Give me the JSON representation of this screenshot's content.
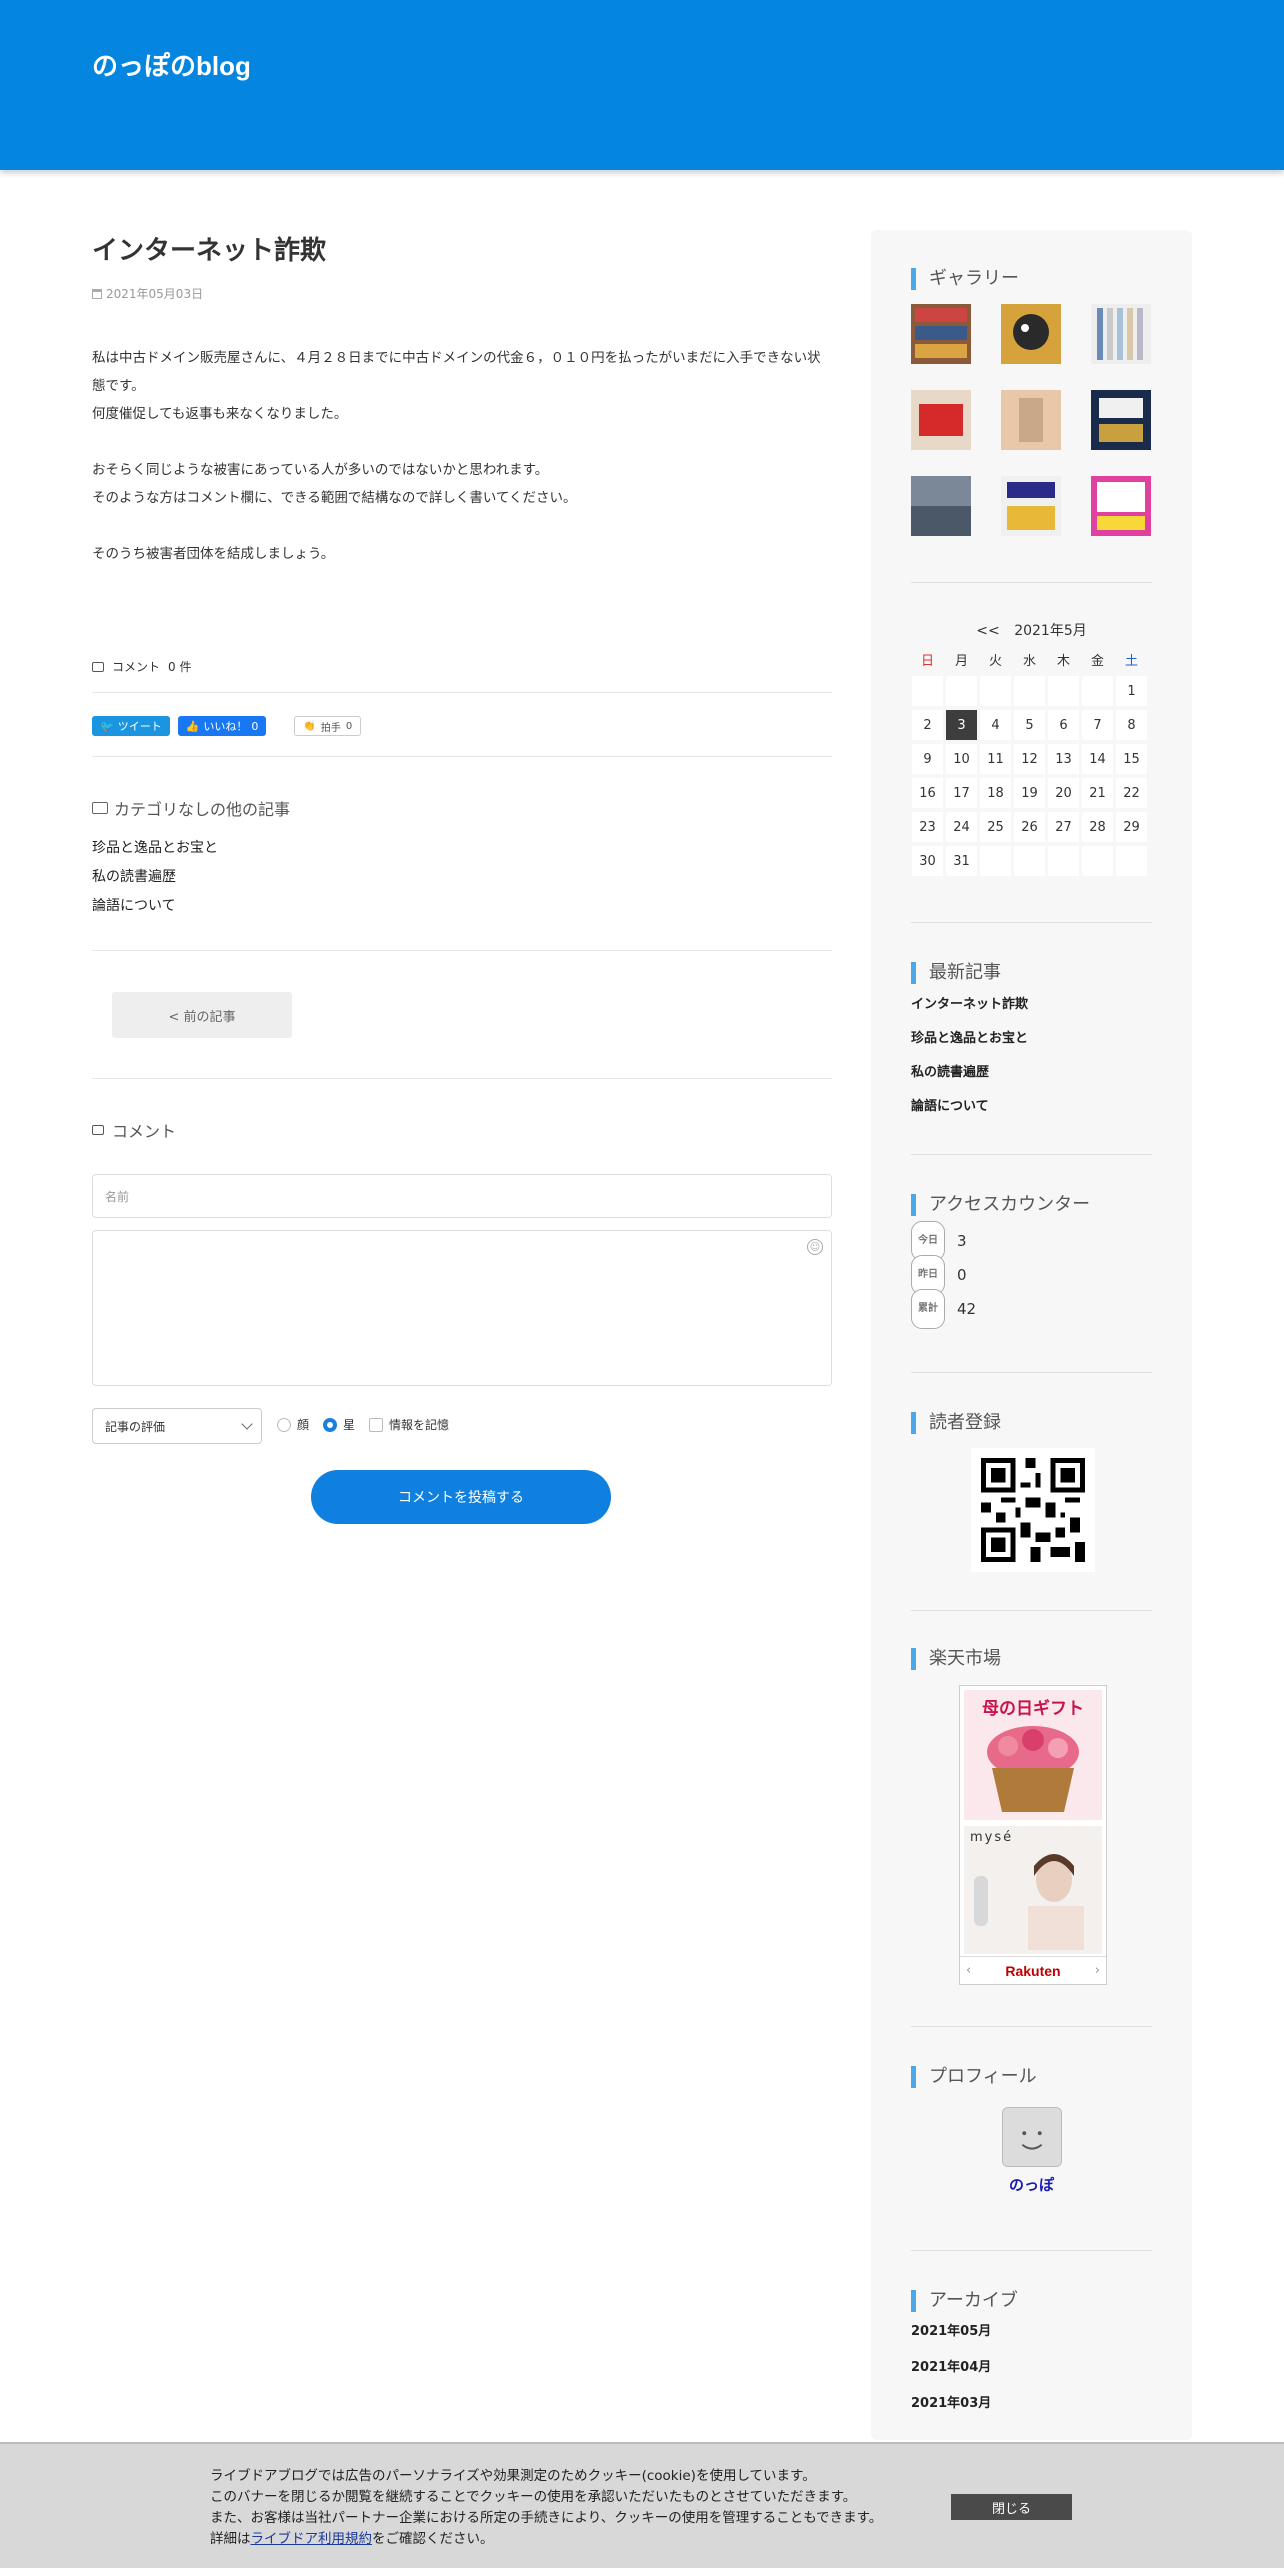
{
  "site": {
    "title": "のっぽのblog"
  },
  "article": {
    "title": "インターネット詐欺",
    "date": "2021年05月03日",
    "paragraphs": [
      "私は中古ドメイン販売屋さんに、４月２８日までに中古ドメインの代金６，０１０円を払ったがいまだに入手できない状態です。",
      "何度催促しても返事も来なくなりました。",
      "",
      "おそらく同じような被害にあっている人が多いのではないかと思われます。",
      "そのような方はコメント欄に、できる範囲で結構なので詳しく書いてください。",
      "",
      "そのうち被害者団体を結成しましょう。"
    ],
    "comment_count_label": "コメント",
    "comment_count": "0 件"
  },
  "share": {
    "tweet": "ツイート",
    "like": "いいね！",
    "like_count": "0",
    "clap": "拍手",
    "clap_count": "0"
  },
  "category": {
    "heading": "カテゴリなしの他の記事",
    "items": [
      "珍品と逸品とお宝と",
      "私の読書遍歴",
      "論語について"
    ]
  },
  "nav": {
    "prev": "< 前の記事"
  },
  "comment_form": {
    "heading": "コメント",
    "name_placeholder": "名前",
    "rating_label": "記事の評価",
    "options": [
      "顔",
      "星",
      "情報を記憶"
    ],
    "submit": "コメントを投稿する"
  },
  "sidebar": {
    "gallery_title": "ギャラリー",
    "calendar": {
      "prev": "<<",
      "month": "2021年5月",
      "weekdays": [
        "日",
        "月",
        "火",
        "水",
        "木",
        "金",
        "土"
      ],
      "sunday_color": "#e03030",
      "saturday_color": "#2060d0",
      "today": "3",
      "cells": [
        "",
        "",
        "",
        "",
        "",
        "",
        "1",
        "2",
        "3",
        "4",
        "5",
        "6",
        "7",
        "8",
        "9",
        "10",
        "11",
        "12",
        "13",
        "14",
        "15",
        "16",
        "17",
        "18",
        "19",
        "20",
        "21",
        "22",
        "23",
        "24",
        "25",
        "26",
        "27",
        "28",
        "29",
        "30",
        "31",
        "",
        "",
        "",
        "",
        ""
      ]
    },
    "recent_title": "最新記事",
    "recent": [
      "インターネット詐欺",
      "珍品と逸品とお宝と",
      "私の読書遍歴",
      "論語について"
    ],
    "counter_title": "アクセスカウンター",
    "counter": [
      {
        "label": "今日",
        "value": "3"
      },
      {
        "label": "昨日",
        "value": "0"
      },
      {
        "label": "累計",
        "value": "42"
      }
    ],
    "reader_title": "読者登録",
    "rakuten_title": "楽天市場",
    "rakuten_banner_1": "母の日ギフト",
    "rakuten_banner_2": "mysé",
    "rakuten_logo": "Rakuten",
    "profile_title": "プロフィール",
    "profile_name": "のっぽ",
    "archive_title": "アーカイブ",
    "archive": [
      "2021年05月",
      "2021年04月",
      "2021年03月"
    ]
  },
  "cookie": {
    "line1": "ライブドアブログでは広告のパーソナライズや効果測定のためクッキー(cookie)を使用しています。",
    "line2": "このバナーを閉じるか閲覧を継続することでクッキーの使用を承認いただいたものとさせていただきます。",
    "line3": "また、お客様は当社パートナー企業における所定の手続きにより、クッキーの使用を管理することもできます。",
    "line4_pre": "詳細は",
    "line4_link": "ライブドア利用規約",
    "line4_post": "をご確認ください。",
    "close": "閉じる"
  },
  "colors": {
    "header": "#0385e0",
    "accent": "#4aa8e8",
    "submit": "#0f7fe0"
  }
}
